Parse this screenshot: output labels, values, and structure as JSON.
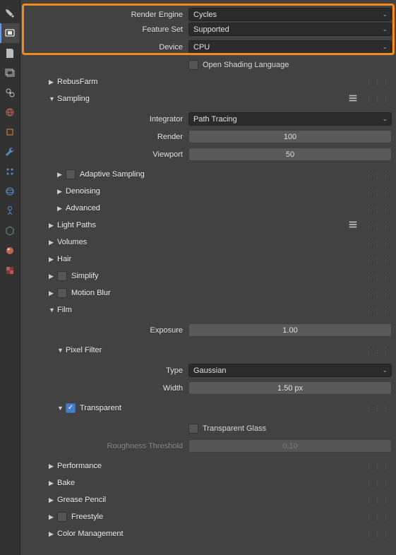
{
  "engine": {
    "label": "Render Engine",
    "value": "Cycles"
  },
  "featureset": {
    "label": "Feature Set",
    "value": "Supported"
  },
  "device": {
    "label": "Device",
    "value": "CPU"
  },
  "osl": {
    "label": "Open Shading Language"
  },
  "sections1": {
    "rebus": "RebusFarm",
    "sampling": "Sampling"
  },
  "sampling": {
    "integrator": {
      "label": "Integrator",
      "value": "Path Tracing"
    },
    "render": {
      "label": "Render",
      "value": "100"
    },
    "viewport": {
      "label": "Viewport",
      "value": "50"
    },
    "adaptive": "Adaptive Sampling",
    "denoising": "Denoising",
    "advanced": "Advanced"
  },
  "sections2": {
    "lightpaths": "Light Paths",
    "volumes": "Volumes",
    "hair": "Hair",
    "simplify": "Simplify",
    "motionblur": "Motion Blur",
    "film": "Film"
  },
  "film": {
    "exposure": {
      "label": "Exposure",
      "value": "1.00"
    },
    "pixelfilter": "Pixel Filter",
    "type": {
      "label": "Type",
      "value": "Gaussian"
    },
    "width": {
      "label": "Width",
      "value": "1.50 px"
    },
    "transparent": "Transparent",
    "transparentglass": "Transparent Glass",
    "roughness": {
      "label": "Roughness Threshold",
      "value": "0.10"
    }
  },
  "sections3": {
    "performance": "Performance",
    "bake": "Bake",
    "grease": "Grease Pencil",
    "freestyle": "Freestyle",
    "colormgmt": "Color Management"
  }
}
